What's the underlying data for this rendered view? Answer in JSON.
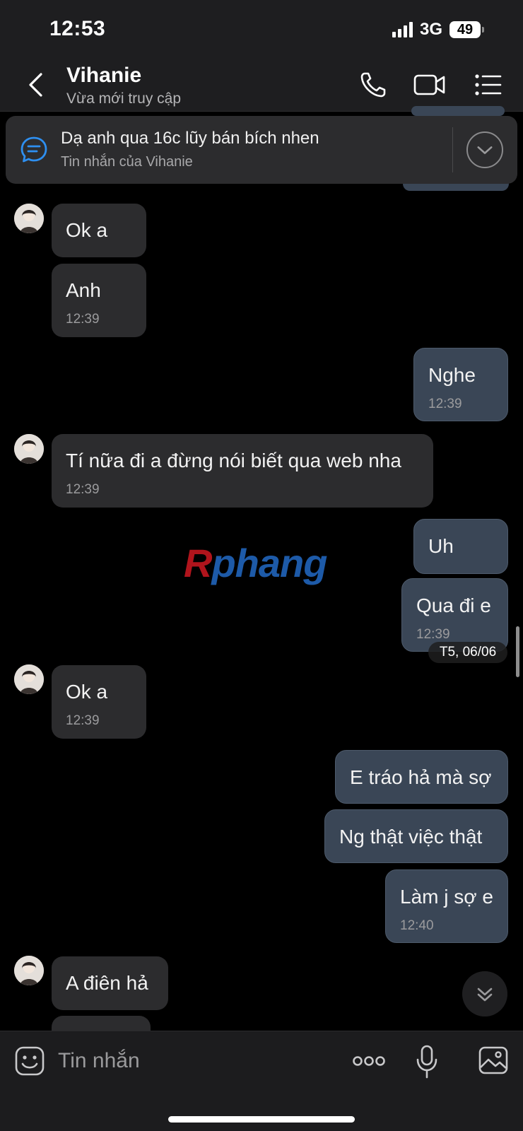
{
  "status_bar": {
    "time": "12:53",
    "network": "3G",
    "battery": "49"
  },
  "header": {
    "contact_name": "Vihanie",
    "contact_status": "Vừa mới truy cập"
  },
  "pinned": {
    "title": "Dạ anh qua 16c lũy bán bích nhen",
    "subtitle": "Tin nhắn của Vihanie"
  },
  "messages": [
    {
      "side": "in",
      "text": "Ok a",
      "time": ""
    },
    {
      "side": "in",
      "text": "Anh",
      "time": "12:39"
    },
    {
      "side": "out",
      "text": "Nghe",
      "time": "12:39"
    },
    {
      "side": "in",
      "text": "Tí nữa đi a đừng nói biết qua web nha",
      "time": "12:39"
    },
    {
      "side": "out",
      "text": "Uh",
      "time": ""
    },
    {
      "side": "out",
      "text": "Qua đi e",
      "time": "12:39"
    },
    {
      "side": "in",
      "text": "Ok a",
      "time": "12:39"
    },
    {
      "side": "out",
      "text": "E tráo hả mà sợ",
      "time": ""
    },
    {
      "side": "out",
      "text": "Ng thật việc thật",
      "time": ""
    },
    {
      "side": "out",
      "text": "Làm j sợ e",
      "time": "12:40"
    },
    {
      "side": "in",
      "text": "A điên hả",
      "time": ""
    }
  ],
  "date_chip": "T5, 06/06",
  "watermark": {
    "first": "R",
    "rest": "phang"
  },
  "input": {
    "placeholder": "Tin nhắn"
  },
  "colors": {
    "incoming_bubble": "#2c2c2e",
    "outgoing_bubble": "#3a4656",
    "link_blue": "#2e8ff0"
  }
}
